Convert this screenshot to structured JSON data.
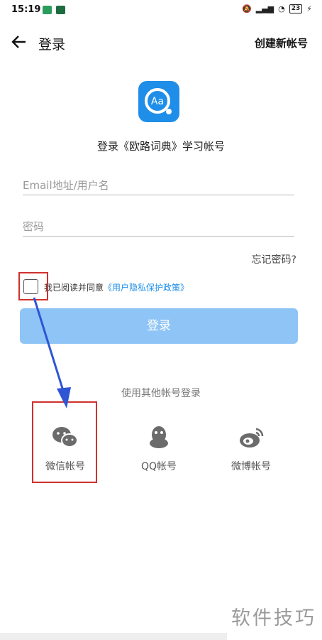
{
  "status_bar": {
    "time": "15:19",
    "battery": "23",
    "app_icon_colors": [
      "#2a9d5c",
      "#1d6b3f"
    ]
  },
  "header": {
    "title": "登录",
    "create_account": "创建新帐号"
  },
  "brand": {
    "logo_text": "Aa",
    "subtitle": "登录《欧路词典》学习帐号",
    "accent": "#1f8ee8"
  },
  "form": {
    "email_placeholder": "Email地址/用户名",
    "password_placeholder": "密码",
    "forgot_password": "忘记密码?",
    "agree_prefix": "我已阅读并同意",
    "agree_link": "《用户隐私保护政策》",
    "login_button": "登录",
    "button_color": "#8fc4f6"
  },
  "other_login": {
    "label": "使用其他帐号登录",
    "options": [
      {
        "label": "微信帐号",
        "icon": "wechat-icon"
      },
      {
        "label": "QQ帐号",
        "icon": "qq-icon"
      },
      {
        "label": "微博帐号",
        "icon": "weibo-icon"
      }
    ]
  },
  "annotation": {
    "highlight_color": "#d0312d",
    "arrow_color": "#2f55d4"
  },
  "watermark": "软件技巧"
}
